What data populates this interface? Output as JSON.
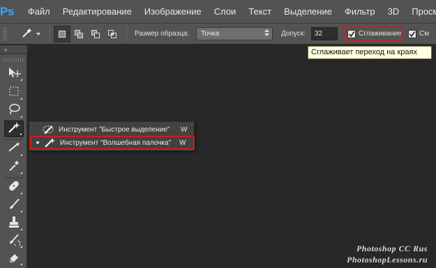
{
  "app": {
    "logo": "Ps"
  },
  "menu": [
    "Файл",
    "Редактирование",
    "Изображение",
    "Слои",
    "Текст",
    "Выделение",
    "Фильтр",
    "3D",
    "Просмотр"
  ],
  "options": {
    "sample_size_label": "Размер образца:",
    "sample_size_value": "Точка",
    "tolerance_label": "Допуск:",
    "tolerance_value": "32",
    "antialias_label": "Сглаживание",
    "antialias_checked": true,
    "contiguous_label": "См",
    "contiguous_checked": true
  },
  "tooltip": "Сглаживает переход на краях",
  "tools_header": "»",
  "tools": [
    {
      "name": "move-tool"
    },
    {
      "name": "marquee-tool"
    },
    {
      "name": "lasso-tool"
    },
    {
      "name": "magic-wand-tool",
      "active": true
    },
    {
      "name": "crop-tool"
    },
    {
      "name": "eyedropper-tool"
    },
    {
      "name": "healing-brush-tool"
    },
    {
      "name": "brush-tool"
    },
    {
      "name": "clone-stamp-tool"
    },
    {
      "name": "history-brush-tool"
    },
    {
      "name": "eraser-tool"
    }
  ],
  "flyout": [
    {
      "label": "Инструмент \"Быстрое выделение\"",
      "key": "W",
      "selected": false
    },
    {
      "label": "Инструмент \"Волшебная палочка\"",
      "key": "W",
      "selected": true
    }
  ],
  "watermark": {
    "line1": "Photoshop  CC  Rus",
    "line2": "PhotoshopLessons.ru"
  },
  "colors": {
    "accent_red": "#d01c1c",
    "ps_blue": "#31a8ff",
    "canvas": "#282828",
    "chrome": "#535353"
  }
}
